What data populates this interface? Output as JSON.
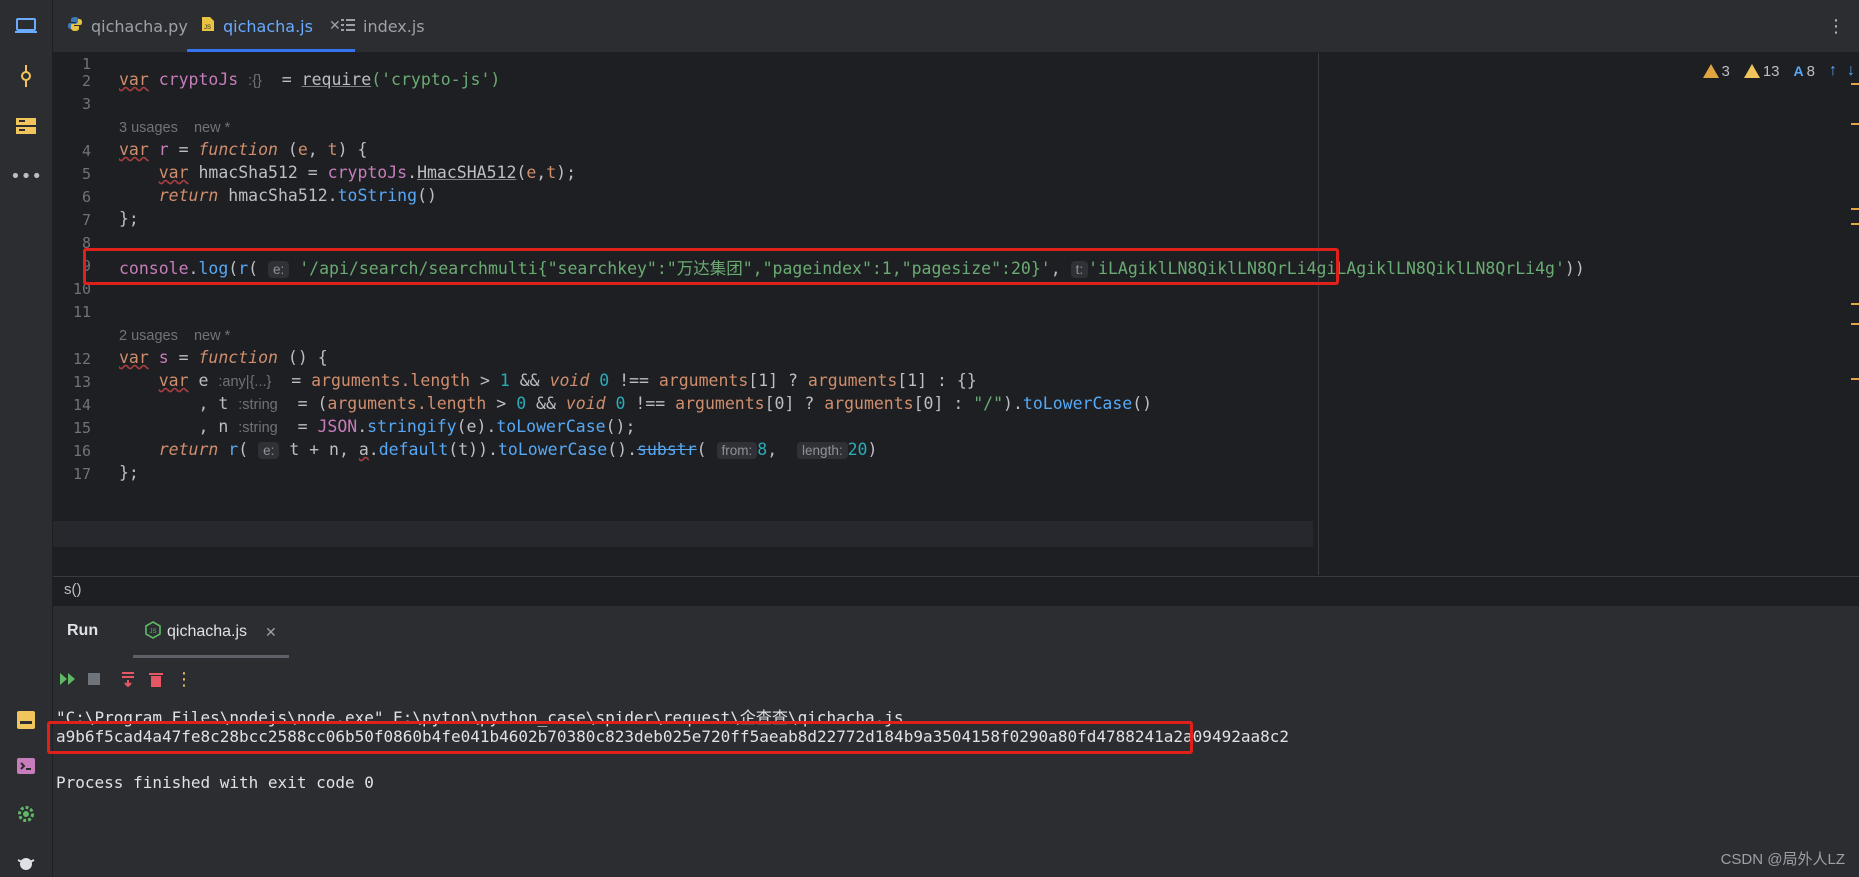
{
  "tabs": [
    {
      "label": "qichacha.py",
      "icon": "python-file-icon"
    },
    {
      "label": "qichacha.js",
      "icon": "js-file-icon",
      "active": true
    },
    {
      "label": "index.js",
      "icon": "list-file-icon"
    }
  ],
  "inspections": {
    "warnings_a": "3",
    "warnings_b": "13",
    "weak": "8"
  },
  "lines": {
    "n1": "1",
    "n2": "2",
    "n3": "3",
    "n4": "4",
    "n5": "5",
    "n6": "6",
    "n7": "7",
    "n8": "8",
    "n9": "9",
    "n10": "10",
    "n11": "11",
    "n12": "12",
    "n13": "13",
    "n14": "14",
    "n15": "15",
    "n16": "16",
    "n17": "17"
  },
  "hints": {
    "usages_r": "3 usages",
    "new_r": "new *",
    "usages_s": "2 usages",
    "new_s": "new *"
  },
  "code": {
    "l2_var": "var",
    "l2_name": "cryptoJs",
    "l2_hint": ":{}",
    "l2_rest": " = ",
    "l2_require": "require",
    "l2_arg": "('crypto-js')",
    "l4_var": "var",
    "l4_name": "r",
    "l4_eq": " = ",
    "l4_fn": "function",
    "l4_params": " (",
    "l4_e": "e",
    "l4_comma": ", ",
    "l4_t": "t",
    "l4_end": ") {",
    "l5_var": "var",
    "l5_name": " hmacSha512 = ",
    "l5_obj": "cryptoJs",
    "l5_dot": ".",
    "l5_call": "HmacSHA512",
    "l5_open": "(",
    "l5_args": "e",
    "l5_c": ",",
    "l5_t": "t",
    "l5_end": ");",
    "l6_ret": "return",
    "l6_obj": " hmacSha512.",
    "l6_call": "toString",
    "l6_end": "()",
    "l7": "};",
    "l9_console": "console",
    "l9_dot": ".",
    "l9_log": "log",
    "l9_open": "(",
    "l9_r": "r",
    "l9_paren": "(",
    "l9_e_hint": "e:",
    "l9_str1": "'/api/search/searchmulti{\"searchkey\":\"万达集团\",\"pageindex\":1,\"pagesize\":20}'",
    "l9_comma": ",",
    "l9_t_hint": "t:",
    "l9_str2": "'iLAgiklLN8QiklLN8QrLi4giLAgiklLN8QiklLN8QrLi4g'",
    "l9_end": "))",
    "l12_var": "var",
    "l12_name": "s",
    "l12_eq": " = ",
    "l12_fn": "function",
    "l12_end": " () {",
    "l13_var": "var",
    "l13_e": " e",
    "l13_hint1": ":any",
    "l13_hint2": "{...}",
    "l13_eq": " = ",
    "l13_args": "arguments",
    "l13_len": ".length",
    "l13_gt": " > ",
    "l13_one": "1",
    "l13_and": " && ",
    "l13_void": "void",
    "l13_zero": " 0",
    "l13_neq": " !== ",
    "l13_a1": "arguments",
    "l13_idx1": "[1]",
    "l13_q": " ? ",
    "l13_a2": "arguments",
    "l13_idx2": "[1]",
    "l13_tail": " : {}",
    "l14_t": ", t",
    "l14_hint": ":string",
    "l14_eq": " = (",
    "l14_args": "arguments",
    "l14_len": ".length",
    "l14_gt": " > ",
    "l14_zero": "0",
    "l14_and": " && ",
    "l14_void": "void",
    "l14_z2": " 0",
    "l14_neq": " !== ",
    "l14_a1": "arguments",
    "l14_idx": "[0]",
    "l14_q": " ? ",
    "l14_a2": "arguments",
    "l14_idx2": "[0]",
    "l14_colon": " : ",
    "l14_slash": "\"/\"",
    "l14_close": ").",
    "l14_lower": "toLowerCase",
    "l14_end": "()",
    "l15_n": ", n",
    "l15_hint": ":string",
    "l15_eq": " = ",
    "l15_json": "JSON",
    "l15_dot": ".",
    "l15_str": "stringify",
    "l15_mid": "(e).",
    "l15_lower": "toLowerCase",
    "l15_end": "();",
    "l16_ret": "return",
    "l16_r": " r",
    "l16_open": "(",
    "l16_e_hint": "e:",
    "l16_tn": "t + n, ",
    "l16_a": "a",
    "l16_dot": ".",
    "l16_def": "default",
    "l16_mid": "(t)).",
    "l16_lower": "toLowerCase",
    "l16_mid2": "().",
    "l16_substr": "substr",
    "l16_paren": "(",
    "l16_from": "from:",
    "l16_eight": "8",
    "l16_c": ",",
    "l16_len": "length:",
    "l16_twenty": "20",
    "l16_end": ")",
    "l17": "};"
  },
  "breadcrumb": "s()",
  "run": {
    "title": "Run",
    "tab_label": "qichacha.js"
  },
  "console": {
    "command": "\"C:\\Program Files\\nodejs\\node.exe\" E:\\pyton\\python_case\\spider\\request\\企查查\\qichacha.js",
    "output": "a9b6f5cad4a47fe8c28bcc2588cc06b50f0860b4fe041b4602b70380c823deb025e720ff5aeab8d22772d184b9a3504158f0290a80fd4788241a2a09492aa8c2",
    "exit": "Process finished with exit code 0"
  },
  "watermark": "CSDN @局外人LZ",
  "colors": {
    "accent": "#3574f0",
    "highlight_box": "#e0201a"
  }
}
